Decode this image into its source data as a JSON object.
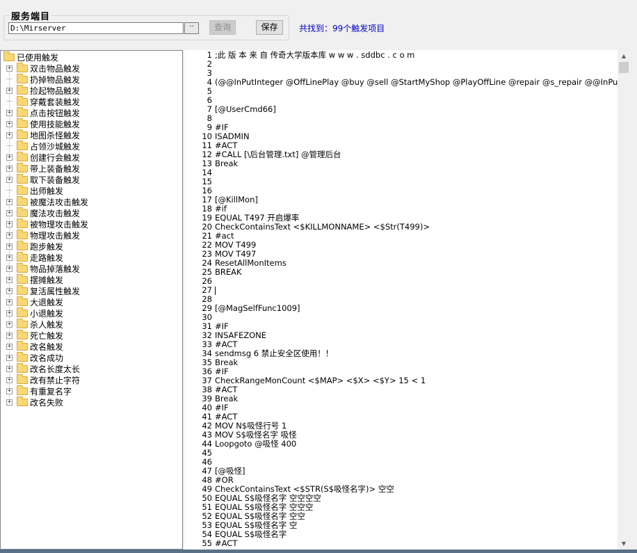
{
  "server_group": {
    "title": "服务端目",
    "path_value": "D:\\Mirserver",
    "browse_label": "··",
    "query_label": "查询",
    "save_label": "保存",
    "found_text": "共找到：99个触发项目"
  },
  "tree": {
    "root_label": "已使用触发",
    "items": [
      {
        "label": "双击物品触发",
        "expandable": true
      },
      {
        "label": "扔掉物品触发",
        "expandable": false
      },
      {
        "label": "捡起物品触发",
        "expandable": true
      },
      {
        "label": "穿戴套装触发",
        "expandable": false
      },
      {
        "label": "点击按钮触发",
        "expandable": true
      },
      {
        "label": "使用技能触发",
        "expandable": true
      },
      {
        "label": "地图杀怪触发",
        "expandable": true
      },
      {
        "label": "占领沙城触发",
        "expandable": false
      },
      {
        "label": "创建行会触发",
        "expandable": true
      },
      {
        "label": "带上装备触发",
        "expandable": true
      },
      {
        "label": "取下装备触发",
        "expandable": true
      },
      {
        "label": "出师触发",
        "expandable": false
      },
      {
        "label": "被魔法攻击触发",
        "expandable": true
      },
      {
        "label": "魔法攻击触发",
        "expandable": true
      },
      {
        "label": "被物理攻击触发",
        "expandable": true
      },
      {
        "label": "物理攻击触发",
        "expandable": true
      },
      {
        "label": "跑步触发",
        "expandable": true
      },
      {
        "label": "走路触发",
        "expandable": true
      },
      {
        "label": "物品掉落触发",
        "expandable": true
      },
      {
        "label": "摆摊触发",
        "expandable": true
      },
      {
        "label": "复活属性触发",
        "expandable": true
      },
      {
        "label": "大退触发",
        "expandable": true
      },
      {
        "label": "小退触发",
        "expandable": true
      },
      {
        "label": "杀人触发",
        "expandable": true
      },
      {
        "label": "死亡触发",
        "expandable": true
      },
      {
        "label": "改名触发",
        "expandable": true
      },
      {
        "label": "改名成功",
        "expandable": true
      },
      {
        "label": "改名长度太长",
        "expandable": true
      },
      {
        "label": "改有禁止字符",
        "expandable": true
      },
      {
        "label": "有重复名字",
        "expandable": true
      },
      {
        "label": "改名失败",
        "expandable": true
      }
    ]
  },
  "editor": {
    "lines": [
      ";此 版 本 来 自 传奇大学版本库 w w w . sddbc . c o m",
      "",
      "",
      "(@@InPutInteger @OffLinePlay @buy @sell @StartMyShop @PlayOffLine @repair @s_repair @@InPutS",
      "",
      "",
      "[@UserCmd66]",
      "",
      "#IF",
      "ISADMIN",
      "#ACT",
      "#CALL [\\后台管理.txt] @管理后台",
      "Break",
      "",
      "",
      "",
      "[@KillMon]",
      "#if",
      "EQUAL T497 开启爆率",
      "CheckContainsText <$KILLMONNAME> <$Str(T499)>",
      "#act",
      "MOV T499",
      "MOV T497",
      "ResetAllMonItems",
      "BREAK",
      "",
      "",
      "",
      "[@MagSelfFunc1009]",
      "",
      "#IF",
      "INSAFEZONE",
      "#ACT",
      "sendmsg 6 禁止安全区使用！！",
      "Break",
      "#IF",
      "CheckRangeMonCount <$MAP> <$X> <$Y> 15 < 1",
      "#ACT",
      "Break",
      "#IF",
      "#ACT",
      "MOV N$吸怪行号 1",
      "MOV S$吸怪名字 吸怪",
      "Loopgoto @吸怪 400",
      "",
      "",
      "[@吸怪]",
      "#OR",
      "CheckContainsText <$STR(S$吸怪名字)> 空空",
      "EQUAL S$吸怪名字 空空空空",
      "EQUAL S$吸怪名字 空空空",
      "EQUAL S$吸怪名字 空空",
      "EQUAL S$吸怪名字 空",
      "EQUAL S$吸怪名字",
      "#ACT"
    ]
  },
  "scrollbar": {
    "up_icon": "▲",
    "down_icon": "▼"
  }
}
